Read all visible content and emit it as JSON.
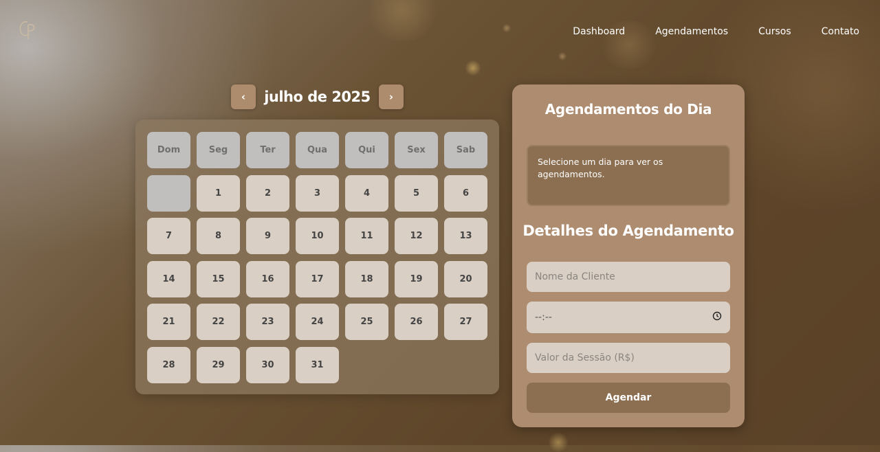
{
  "nav": {
    "logo_alt": "CP",
    "items": [
      {
        "label": "Dashboard"
      },
      {
        "label": "Agendamentos"
      },
      {
        "label": "Cursos"
      },
      {
        "label": "Contato"
      }
    ]
  },
  "calendar": {
    "month_label": "julho de 2025",
    "prev_icon": "‹",
    "next_icon": "›",
    "weekdays": [
      "Dom",
      "Seg",
      "Ter",
      "Qua",
      "Qui",
      "Sex",
      "Sab"
    ],
    "leading_empty_days": 1,
    "days": [
      "1",
      "2",
      "3",
      "4",
      "5",
      "6",
      "7",
      "8",
      "9",
      "10",
      "11",
      "12",
      "13",
      "14",
      "15",
      "16",
      "17",
      "18",
      "19",
      "20",
      "21",
      "22",
      "23",
      "24",
      "25",
      "26",
      "27",
      "28",
      "29",
      "30",
      "31"
    ]
  },
  "panel": {
    "title": "Agendamentos do Dia",
    "info_text": "Selecione um dia para ver os agendamentos.",
    "details_title": "Detalhes do Agendamento",
    "client_placeholder": "Nome da Cliente",
    "time_value": "--:--",
    "value_placeholder": "Valor da Sessão (R$)",
    "submit_label": "Agendar"
  },
  "colors": {
    "accent": "#ad8c70",
    "button_dark": "#8c6e50",
    "day_cell": "#d9cfc4",
    "weekday_cell": "#c0bfbe"
  }
}
